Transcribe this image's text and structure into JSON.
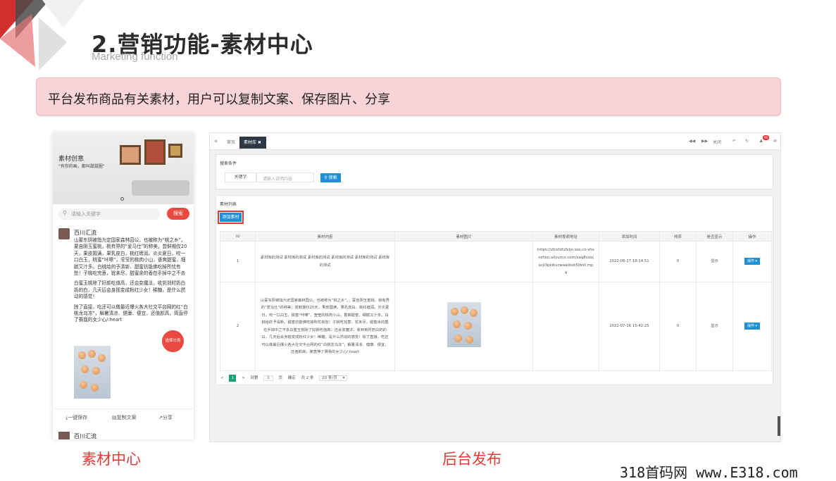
{
  "slide": {
    "title": "2.营销功能-素材中心",
    "subtitle": "Marketing function",
    "banner": "平台发布商品有关素材，用户可以复制文案、保存图片、分享",
    "caption_left": "素材中心",
    "caption_right": "后台发布",
    "footer": "318首码网 www.E318.com"
  },
  "phone": {
    "hero_title": "素材创意",
    "hero_sub": "\"有你的画，都叫甜甜圈\"",
    "search_placeholder": "请输入关键字",
    "search_button": "搜索",
    "username": "百川汇流",
    "post_p1": "山蒙东阴被指为定国家森林园公，也被称为“桃之乡”。 蒙自阴玉蜜桃，桃有界的“爱马仕”的称美，尝鲜期仅20天，果皮圆满，果乳皮白，桃红缠润。炎炎夏日，咬一口白玉，桃蜜“咔嚓”，莹莹的桃肉小山，香爽甜蜜，细腻又汁多。白桃给的予清新、甜蜜彷能佛吃掉所忧有愁！子桃吃完意，犹未尽，甜蜜余的香在手掉中之不去",
    "post_p2": "白蜜玉桃除了好颜吃值高，还会变魔法，收到到时奶白奶的白，几天后会身摇变成粉红少女！稀糖，是什么然动的感觉！",
    "post_p3": "除了直接，吃还可以做最近爆火各大社交平台网的红“白桃龙乌冻”，解暑清凉、健康、便宜，还值颜高，简直停了赛我的女少心/:heart",
    "fab": "选择分类",
    "action_save": "一键保存",
    "action_copy": "复制文案",
    "action_share": "分享",
    "username2": "百川汇流"
  },
  "admin": {
    "topbar_home": "首页",
    "topbar_tab": "素材库",
    "topbar_close": "关闭",
    "badge": "99",
    "search_section": "搜索条件",
    "keyword_label": "关键字",
    "keyword_placeholder": "请输入说明内容",
    "search_button": "搜索",
    "list_section": "素材列表",
    "add_button": "添加素材",
    "columns": [
      "Id",
      "素材内容",
      "素材图片",
      "素材视频地址",
      "添加时间",
      "排序",
      "是否显示",
      "操作"
    ],
    "rows": [
      {
        "id": "1",
        "content": "素材库的测试 素材库的测试 素材库的测试 素材库的测试 素材库的测试 素材库的测试",
        "video": "https://zhishifufeijn.oss-cn-shenzhen.aliyuncs.com/xaq8vuojacjl3pkibxcwaaiibsb5lbnll.mp4",
        "time": "2022-06-27 18:14:51",
        "sort": "0",
        "show": "显示",
        "op": "操作"
      },
      {
        "id": "2",
        "content": "山蒙东阴被指为定国家森林园公，也被称为“桃之乡”。；蒙自阴玉蜜桃，桃有界的“爱马仕”的称美；尝鲜期仅20天，果皮圆满，果乳皮白，桃红缠润。炎炎夏日，咬一口白玉，桃蜜“咔嚓”，莹莹的桃肉小山，香爽甜蜜，细腻又汁多。白桃给的予清新、甜蜜彷能佛吃掉所忧有愁！子桃吃完意，犹未尽，甜蜜余的香在手掉中之不去白蜜玉桃除了好颜吃值高，还会变魔法，收到到时奶白奶的白，几天后会身摇变成粉红少女！稀糖，是什么然动的感觉！除了直接，吃还可以做最近爆火各大社交平台网的红“白桃龙乌冻”，解暑清凉、健康、便宜，还值颜高，简直停了赛我的女少心/:heart",
        "video": "",
        "time": "2022-07-16 15:42:25",
        "sort": "0",
        "show": "显示",
        "op": "操作"
      }
    ],
    "pager": {
      "prev": "<",
      "page": "1",
      "next": ">",
      "goto": "到第",
      "goto_val": "1",
      "page_unit": "页",
      "confirm": "确定",
      "total": "共 2 条",
      "per_page": "20 条/页"
    }
  }
}
